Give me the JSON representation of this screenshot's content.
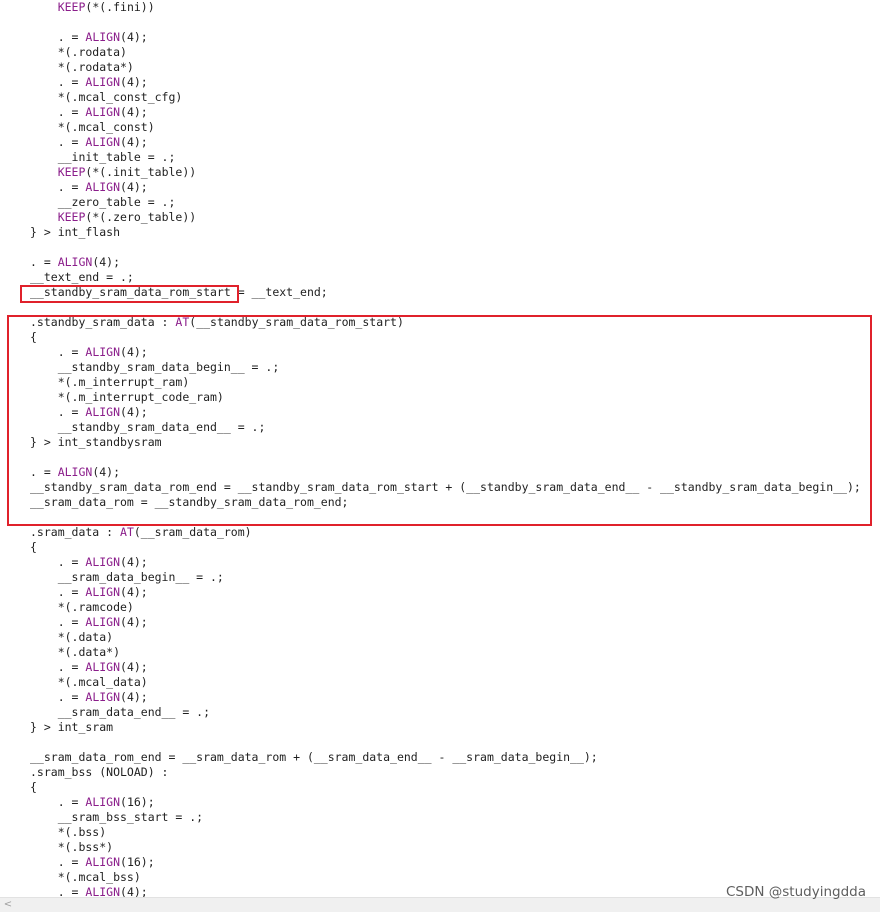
{
  "code_lines": [
    [
      {
        "t": "    "
      },
      {
        "t": "KEEP",
        "kw": true
      },
      {
        "t": "(*(.fini))"
      }
    ],
    [
      {
        "t": ""
      }
    ],
    [
      {
        "t": "    . = "
      },
      {
        "t": "ALIGN",
        "kw": true
      },
      {
        "t": "(4);"
      }
    ],
    [
      {
        "t": "    *(.rodata)"
      }
    ],
    [
      {
        "t": "    *(.rodata*)"
      }
    ],
    [
      {
        "t": "    . = "
      },
      {
        "t": "ALIGN",
        "kw": true
      },
      {
        "t": "(4);"
      }
    ],
    [
      {
        "t": "    *(.mcal_const_cfg)"
      }
    ],
    [
      {
        "t": "    . = "
      },
      {
        "t": "ALIGN",
        "kw": true
      },
      {
        "t": "(4);"
      }
    ],
    [
      {
        "t": "    *(.mcal_const)"
      }
    ],
    [
      {
        "t": "    . = "
      },
      {
        "t": "ALIGN",
        "kw": true
      },
      {
        "t": "(4);"
      }
    ],
    [
      {
        "t": "    __init_table = .;"
      }
    ],
    [
      {
        "t": "    "
      },
      {
        "t": "KEEP",
        "kw": true
      },
      {
        "t": "(*(.init_table))"
      }
    ],
    [
      {
        "t": "    . = "
      },
      {
        "t": "ALIGN",
        "kw": true
      },
      {
        "t": "(4);"
      }
    ],
    [
      {
        "t": "    __zero_table = .;"
      }
    ],
    [
      {
        "t": "    "
      },
      {
        "t": "KEEP",
        "kw": true
      },
      {
        "t": "(*(.zero_table))"
      }
    ],
    [
      {
        "t": "} > int_flash"
      }
    ],
    [
      {
        "t": ""
      }
    ],
    [
      {
        "t": ". = "
      },
      {
        "t": "ALIGN",
        "kw": true
      },
      {
        "t": "(4);"
      }
    ],
    [
      {
        "t": "__text_end = .;"
      }
    ],
    [
      {
        "t": "__standby_sram_data_rom_start = __text_end;"
      }
    ],
    [
      {
        "t": ""
      }
    ],
    [
      {
        "t": ".standby_sram_data : "
      },
      {
        "t": "AT",
        "kw": true
      },
      {
        "t": "(__standby_sram_data_rom_start)"
      }
    ],
    [
      {
        "t": "{"
      }
    ],
    [
      {
        "t": "    . = "
      },
      {
        "t": "ALIGN",
        "kw": true
      },
      {
        "t": "(4);"
      }
    ],
    [
      {
        "t": "    __standby_sram_data_begin__ = .;"
      }
    ],
    [
      {
        "t": "    *(.m_interrupt_ram)"
      }
    ],
    [
      {
        "t": "    *(.m_interrupt_code_ram)"
      }
    ],
    [
      {
        "t": "    . = "
      },
      {
        "t": "ALIGN",
        "kw": true
      },
      {
        "t": "(4);"
      }
    ],
    [
      {
        "t": "    __standby_sram_data_end__ = .;"
      }
    ],
    [
      {
        "t": "} > int_standbysram"
      }
    ],
    [
      {
        "t": ""
      }
    ],
    [
      {
        "t": ". = "
      },
      {
        "t": "ALIGN",
        "kw": true
      },
      {
        "t": "(4);"
      }
    ],
    [
      {
        "t": "__standby_sram_data_rom_end = __standby_sram_data_rom_start + (__standby_sram_data_end__ - __standby_sram_data_begin__);"
      }
    ],
    [
      {
        "t": "__sram_data_rom = __standby_sram_data_rom_end;"
      }
    ],
    [
      {
        "t": ""
      }
    ],
    [
      {
        "t": ".sram_data : "
      },
      {
        "t": "AT",
        "kw": true
      },
      {
        "t": "(__sram_data_rom)"
      }
    ],
    [
      {
        "t": "{"
      }
    ],
    [
      {
        "t": "    . = "
      },
      {
        "t": "ALIGN",
        "kw": true
      },
      {
        "t": "(4);"
      }
    ],
    [
      {
        "t": "    __sram_data_begin__ = .;"
      }
    ],
    [
      {
        "t": "    . = "
      },
      {
        "t": "ALIGN",
        "kw": true
      },
      {
        "t": "(4);"
      }
    ],
    [
      {
        "t": "    *(.ramcode)"
      }
    ],
    [
      {
        "t": "    . = "
      },
      {
        "t": "ALIGN",
        "kw": true
      },
      {
        "t": "(4);"
      }
    ],
    [
      {
        "t": "    *(.data)"
      }
    ],
    [
      {
        "t": "    *(.data*)"
      }
    ],
    [
      {
        "t": "    . = "
      },
      {
        "t": "ALIGN",
        "kw": true
      },
      {
        "t": "(4);"
      }
    ],
    [
      {
        "t": "    *(.mcal_data)"
      }
    ],
    [
      {
        "t": "    . = "
      },
      {
        "t": "ALIGN",
        "kw": true
      },
      {
        "t": "(4);"
      }
    ],
    [
      {
        "t": "    __sram_data_end__ = .;"
      }
    ],
    [
      {
        "t": "} > int_sram"
      }
    ],
    [
      {
        "t": ""
      }
    ],
    [
      {
        "t": "__sram_data_rom_end = __sram_data_rom + (__sram_data_end__ - __sram_data_begin__);"
      }
    ],
    [
      {
        "t": ".sram_bss (NOLOAD) :"
      }
    ],
    [
      {
        "t": "{"
      }
    ],
    [
      {
        "t": "    . = "
      },
      {
        "t": "ALIGN",
        "kw": true
      },
      {
        "t": "(16);"
      }
    ],
    [
      {
        "t": "    __sram_bss_start = .;"
      }
    ],
    [
      {
        "t": "    *(.bss)"
      }
    ],
    [
      {
        "t": "    *(.bss*)"
      }
    ],
    [
      {
        "t": "    . = "
      },
      {
        "t": "ALIGN",
        "kw": true
      },
      {
        "t": "(16);"
      }
    ],
    [
      {
        "t": "    *(.mcal_bss)"
      }
    ],
    [
      {
        "t": "    . = "
      },
      {
        "t": "ALIGN",
        "kw": true
      },
      {
        "t": "(4);"
      }
    ]
  ],
  "colors": {
    "keyword": "#8b1e8b",
    "text": "#1f1f1f",
    "highlight_border": "#e0212b"
  },
  "scrollbar": {
    "left_arrow": "<"
  },
  "watermark": "CSDN @studyingdda"
}
